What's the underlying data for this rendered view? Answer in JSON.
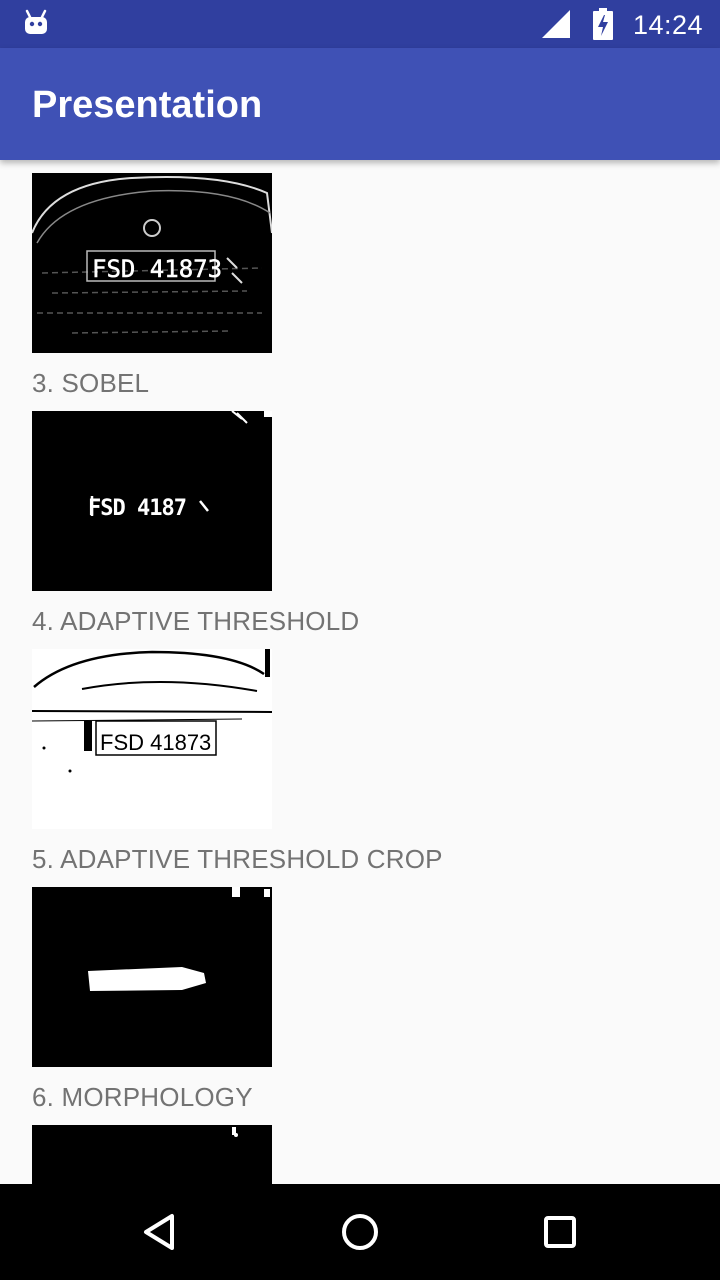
{
  "status_bar": {
    "time": "14:24",
    "icons": [
      "android-icon",
      "signal-icon",
      "battery-charging-icon"
    ]
  },
  "app_bar": {
    "title": "Presentation"
  },
  "steps": [
    {
      "caption": "",
      "plate_text": "FSD 41873"
    },
    {
      "caption": "3. SOBEL",
      "plate_text": "FSD 4187"
    },
    {
      "caption": "4. ADAPTIVE THRESHOLD",
      "plate_text": "FSD 41873"
    },
    {
      "caption": "5. ADAPTIVE THRESHOLD CROP"
    },
    {
      "caption": "6. MORPHOLOGY"
    }
  ],
  "nav_bar": {
    "buttons": [
      "back-icon",
      "home-icon",
      "recents-icon"
    ]
  }
}
